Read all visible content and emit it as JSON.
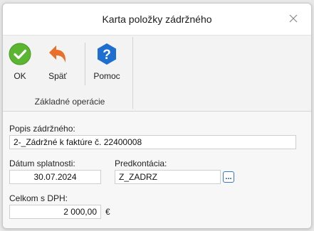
{
  "window": {
    "title": "Karta položky zádržného"
  },
  "ribbon": {
    "buttons": [
      {
        "label": "OK",
        "icon": "ok-check-icon",
        "color": "#5cb531"
      },
      {
        "label": "Späť",
        "icon": "back-arrow-icon",
        "color": "#e8702a"
      },
      {
        "label": "Pomoc",
        "icon": "help-question-icon",
        "color": "#1e6fd0"
      }
    ],
    "group_label": "Základné operácie"
  },
  "form": {
    "description_label": "Popis zádržného:",
    "description_value": "2-_Zádržné k faktúre č. 22400008",
    "due_date_label": "Dátum splatnosti:",
    "due_date_value": "30.07.2024",
    "precontation_label": "Predkontácia:",
    "precontation_value": "Z_ZADRZ",
    "lookup_button_label": "...",
    "total_label": "Celkom s DPH:",
    "total_value": "2 000,00",
    "currency": "€"
  }
}
